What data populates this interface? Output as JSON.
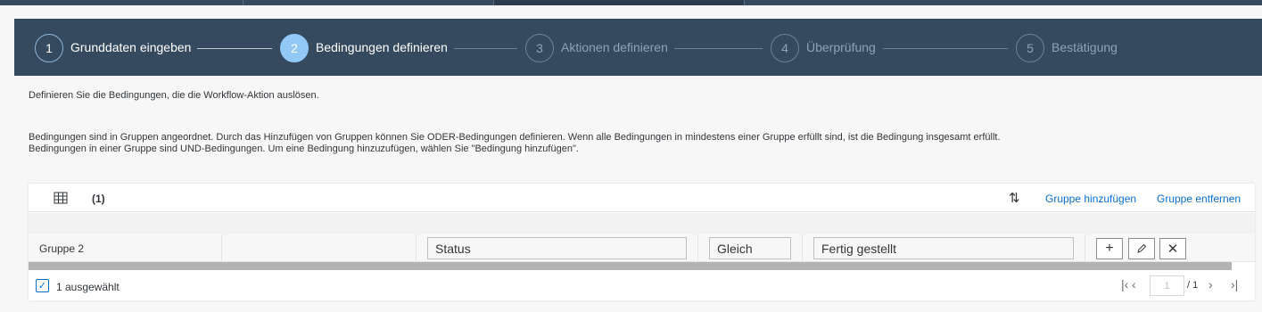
{
  "wizard": {
    "steps": [
      {
        "number": "1",
        "label": "Grunddaten eingeben"
      },
      {
        "number": "2",
        "label": "Bedingungen definieren"
      },
      {
        "number": "3",
        "label": "Aktionen definieren"
      },
      {
        "number": "4",
        "label": "Überprüfung"
      },
      {
        "number": "5",
        "label": "Bestätigung"
      }
    ]
  },
  "description": {
    "intro": "Definieren Sie die Bedingungen, die die Workflow-Aktion auslösen.",
    "line1": "Bedingungen sind in Gruppen angeordnet. Durch das Hinzufügen von Gruppen können Sie ODER-Bedingungen definieren. Wenn alle Bedingungen in mindestens einer Gruppe erfüllt sind, ist die Bedingung insgesamt erfüllt.",
    "line2": "Bedingungen in einer Gruppe sind UND-Bedingungen. Um eine Bedingung hinzuzufügen, wählen Sie \"Bedingung hinzufügen\"."
  },
  "table": {
    "count": "(1)",
    "add_group": "Gruppe hinzufügen",
    "remove_group": "Gruppe entfernen",
    "row": {
      "group": "Gruppe 2",
      "field": "Status",
      "operator": "Gleich",
      "value": "Fertig gestellt"
    },
    "footer": {
      "selected": "1 ausgewählt",
      "page": "1",
      "total": "/ 1"
    }
  }
}
